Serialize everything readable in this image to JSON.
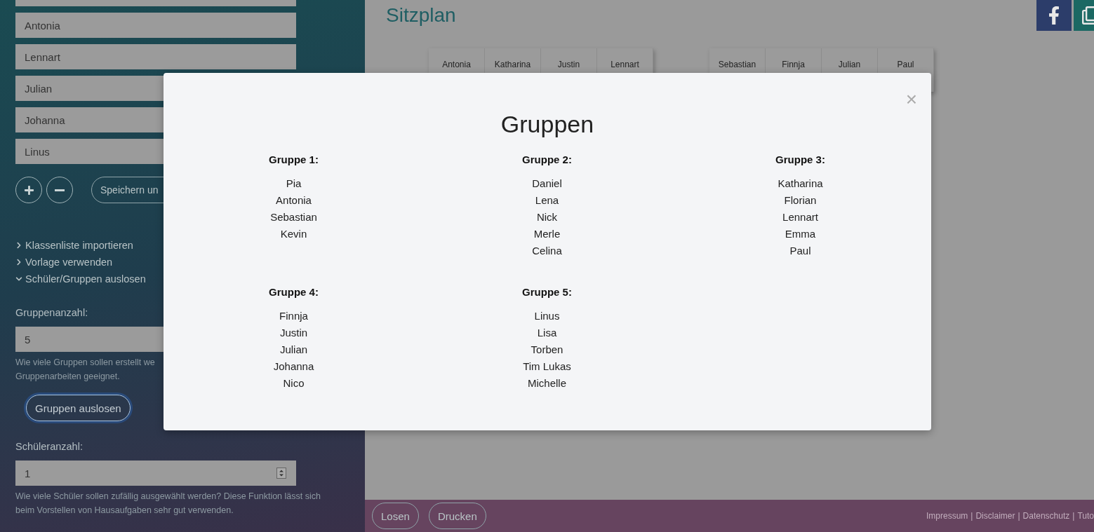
{
  "sidebar": {
    "student_fields": [
      "Antonia",
      "Lennart",
      "Julian",
      "Johanna",
      "Linus"
    ],
    "save_button": "Speichern un",
    "sections": [
      {
        "label": "Klassenliste importieren",
        "expanded": false
      },
      {
        "label": "Vorlage verwenden",
        "expanded": false
      },
      {
        "label": "Schüler/Gruppen auslosen",
        "expanded": true
      }
    ],
    "group_count": {
      "label": "Gruppenanzahl:",
      "value": "5",
      "help": [
        "Wie viele Gruppen sollen erstellt we",
        "Gruppenarbeiten geeignet."
      ]
    },
    "draw_groups_button": "Gruppen auslosen",
    "student_count": {
      "label": "Schüleranzahl:",
      "value": "1",
      "help": [
        "Wie viele Schüler sollen zufällig ausgewählt werden? Diese Funktion lässt sich",
        "beim Vorstellen von Hausaufgaben sehr gut verwenden."
      ]
    }
  },
  "main": {
    "title": "Sitzplan",
    "table_groups": [
      [
        "Antonia",
        "Katharina",
        "Justin",
        "Lennart"
      ],
      [
        "Sebastian",
        "Finnja",
        "Julian",
        "Paul"
      ]
    ]
  },
  "footer": {
    "buttons": [
      "Losen",
      "Drucken"
    ],
    "links": [
      "Impressum",
      "Disclaimer",
      "Datenschutz",
      "Tuto"
    ],
    "separator": "|"
  },
  "modal": {
    "close": "×",
    "title": "Gruppen",
    "groups": [
      {
        "title": "Gruppe 1:",
        "members": [
          "Pia",
          "Antonia",
          "Sebastian",
          "Kevin"
        ]
      },
      {
        "title": "Gruppe 2:",
        "members": [
          "Daniel",
          "Lena",
          "Nick",
          "Merle",
          "Celina"
        ]
      },
      {
        "title": "Gruppe 3:",
        "members": [
          "Katharina",
          "Florian",
          "Lennart",
          "Emma",
          "Paul"
        ]
      },
      {
        "title": "Gruppe 4:",
        "members": [
          "Finnja",
          "Justin",
          "Julian",
          "Johanna",
          "Nico"
        ]
      },
      {
        "title": "Gruppe 5:",
        "members": [
          "Linus",
          "Lisa",
          "Torben",
          "Tim Lukas",
          "Michelle"
        ]
      }
    ]
  }
}
